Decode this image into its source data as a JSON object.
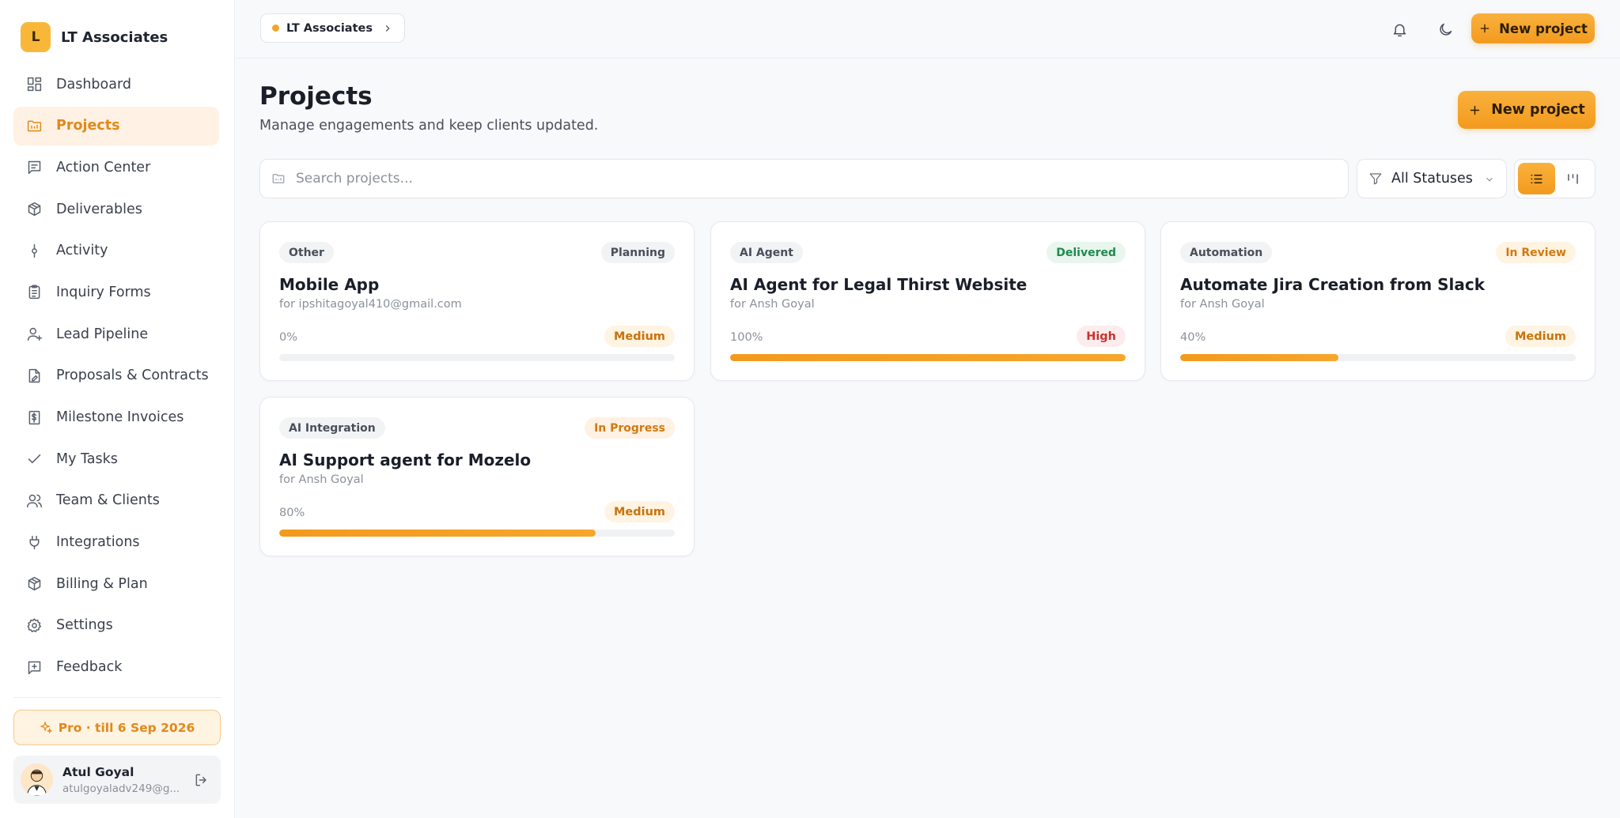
{
  "brand": {
    "initial": "L",
    "name": "LT Associates"
  },
  "nav": [
    {
      "label": "Dashboard",
      "icon": "dashboard-icon",
      "active": false
    },
    {
      "label": "Projects",
      "icon": "folder-icon",
      "active": true
    },
    {
      "label": "Action Center",
      "icon": "message-square-icon",
      "active": false
    },
    {
      "label": "Deliverables",
      "icon": "package-icon",
      "active": false
    },
    {
      "label": "Activity",
      "icon": "activity-icon",
      "active": false
    },
    {
      "label": "Inquiry Forms",
      "icon": "clipboard-icon",
      "active": false
    },
    {
      "label": "Lead Pipeline",
      "icon": "user-plus-icon",
      "active": false
    },
    {
      "label": "Proposals & Contracts",
      "icon": "file-signature-icon",
      "active": false
    },
    {
      "label": "Milestone Invoices",
      "icon": "receipt-icon",
      "active": false
    },
    {
      "label": "My Tasks",
      "icon": "check-icon",
      "active": false
    },
    {
      "label": "Team & Clients",
      "icon": "users-icon",
      "active": false
    },
    {
      "label": "Integrations",
      "icon": "plug-icon",
      "active": false
    },
    {
      "label": "Billing & Plan",
      "icon": "package-icon",
      "active": false
    },
    {
      "label": "Settings",
      "icon": "gear-icon",
      "active": false
    },
    {
      "label": "Feedback",
      "icon": "message-plus-icon",
      "active": false
    }
  ],
  "plan": {
    "label": "Pro · till 6 Sep 2026"
  },
  "user": {
    "name": "Atul Goyal",
    "email": "atulgoyaladv249@g..."
  },
  "topbar": {
    "breadcrumb": "LT Associates",
    "new_project": "New project"
  },
  "page": {
    "title": "Projects",
    "subtitle": "Manage engagements and keep clients updated.",
    "new_project": "New project"
  },
  "search": {
    "placeholder": "Search projects..."
  },
  "filter": {
    "selected": "All Statuses"
  },
  "colors": {
    "accent": "#f39a1e",
    "status_planning_bg": "#f2f3f5",
    "status_planning_fg": "#4a4f5b",
    "status_delivered_bg": "#e8f6ee",
    "status_delivered_fg": "#1f8a4c",
    "status_review_bg": "#fff3e2",
    "status_review_fg": "#d07a10",
    "status_progress_bg": "#fff1e3",
    "status_progress_fg": "#d07a10",
    "prio_medium_bg": "#fff3e2",
    "prio_medium_fg": "#c8730c",
    "prio_high_bg": "#fdeced",
    "prio_high_fg": "#c8312f"
  },
  "projects": [
    {
      "category": "Other",
      "status": "Planning",
      "status_kind": "planning",
      "title": "Mobile App",
      "client": "for ipshitagoyal410@gmail.com",
      "progress_label": "0%",
      "progress": 0,
      "priority": "Medium",
      "priority_kind": "medium"
    },
    {
      "category": "AI Agent",
      "status": "Delivered",
      "status_kind": "delivered",
      "title": "AI Agent for Legal Thirst Website",
      "client": "for Ansh Goyal",
      "progress_label": "100%",
      "progress": 100,
      "priority": "High",
      "priority_kind": "high"
    },
    {
      "category": "Automation",
      "status": "In Review",
      "status_kind": "review",
      "title": "Automate Jira Creation from Slack",
      "client": "for Ansh Goyal",
      "progress_label": "40%",
      "progress": 40,
      "priority": "Medium",
      "priority_kind": "medium"
    },
    {
      "category": "AI Integration",
      "status": "In Progress",
      "status_kind": "progress",
      "title": "AI Support agent for Mozelo",
      "client": "for Ansh Goyal",
      "progress_label": "80%",
      "progress": 80,
      "priority": "Medium",
      "priority_kind": "medium"
    }
  ]
}
